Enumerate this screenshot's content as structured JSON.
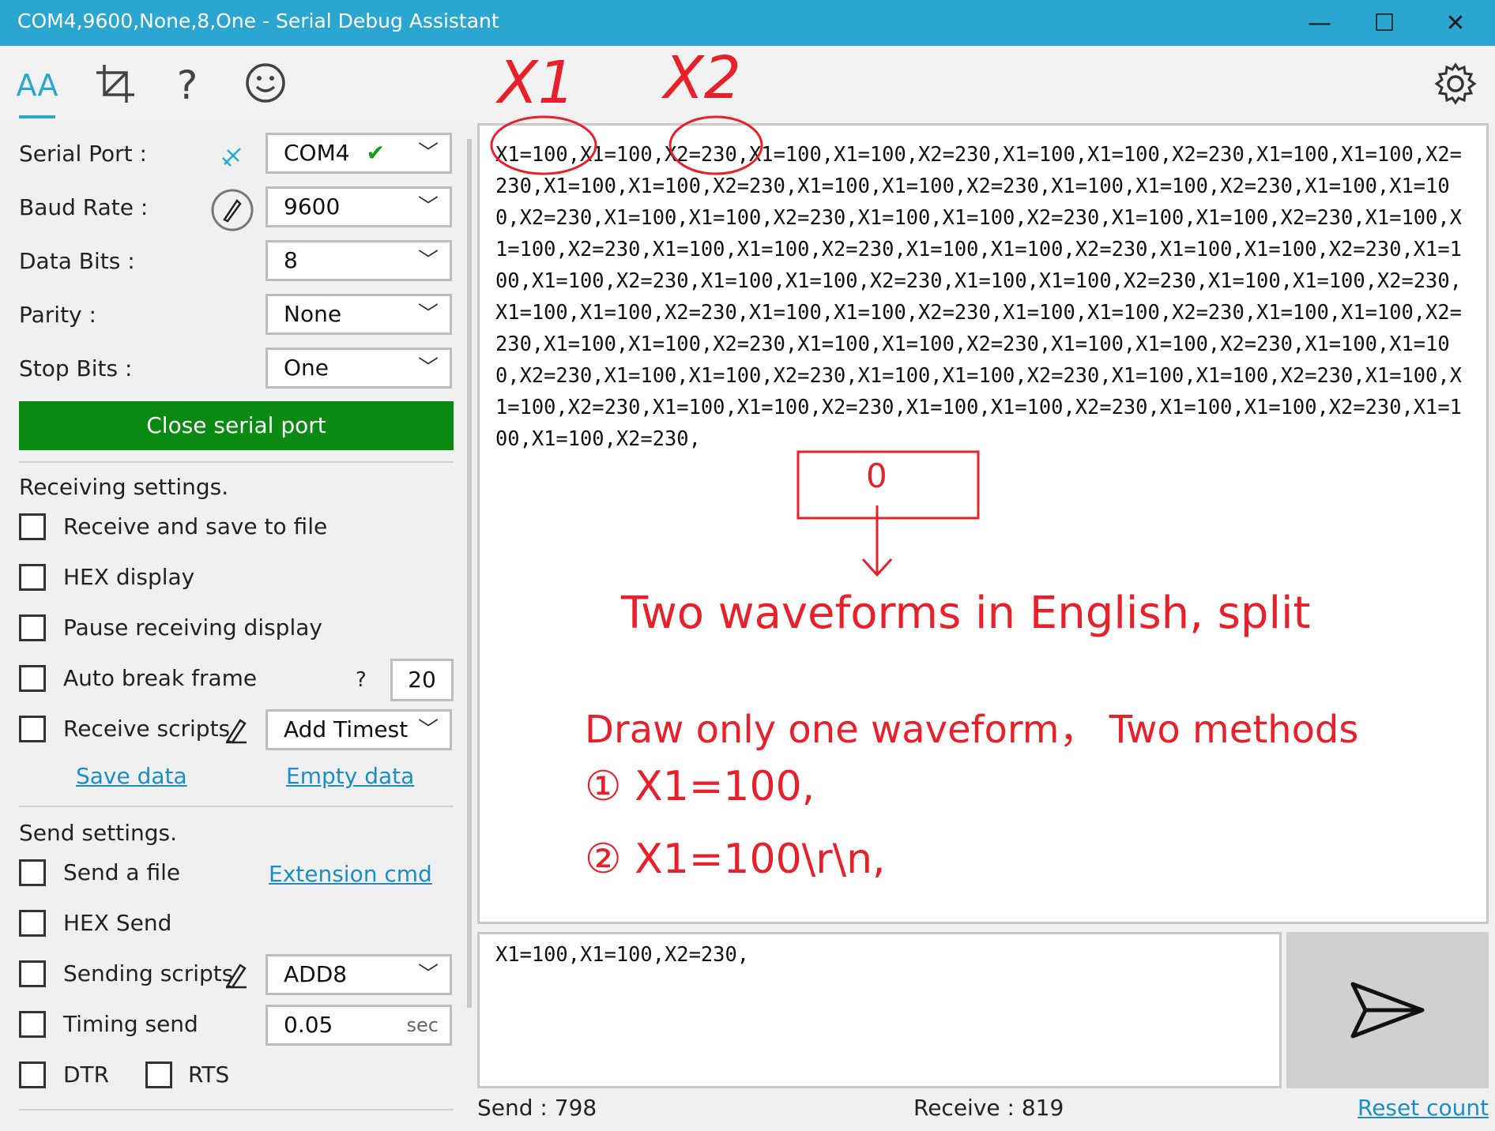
{
  "window": {
    "title": "COM4,9600,None,8,One - Serial Debug Assistant",
    "minimize": "—",
    "maximize": "☐",
    "close": "✕"
  },
  "toolbar": {
    "font_icon": "AA",
    "crop_icon": "crop-icon",
    "help": "?",
    "smile_icon": "smiley-icon",
    "settings_icon": "gear-icon"
  },
  "serial": {
    "port_label": "Serial Port :",
    "port_value": "COM4",
    "baud_label": "Baud Rate :",
    "baud_value": "9600",
    "databits_label": "Data Bits :",
    "databits_value": "8",
    "parity_label": "Parity :",
    "parity_value": "None",
    "stopbits_label": "Stop Bits :",
    "stopbits_value": "One",
    "close_button": "Close serial port"
  },
  "receiving": {
    "heading": "Receiving settings.",
    "save_to_file": "Receive and save to file",
    "hex_display": "HEX display",
    "pause_display": "Pause receiving display",
    "auto_break": "Auto break frame",
    "auto_break_help": "?",
    "auto_break_value": "20",
    "receive_scripts": "Receive scripts",
    "receive_scripts_value": "Add Timest",
    "save_data": "Save data",
    "empty_data": "Empty data"
  },
  "sending": {
    "heading": "Send settings.",
    "send_file": "Send a file",
    "extension_cmd": "Extension cmd",
    "hex_send": "HEX Send",
    "sending_scripts": "Sending scripts",
    "sending_scripts_value": "ADD8",
    "timing_send": "Timing send",
    "timing_value": "0.05",
    "timing_unit": "sec",
    "dtr": "DTR",
    "rts": "RTS"
  },
  "receive_area": {
    "text": "X1=100,X1=100,X2=230,X1=100,X1=100,X2=230,X1=100,X1=100,X2=230,X1=100,X1=100,X2=230,X1=100,X1=100,X2=230,X1=100,X1=100,X2=230,X1=100,X1=100,X2=230,X1=100,X1=100,X2=230,X1=100,X1=100,X2=230,X1=100,X1=100,X2=230,X1=100,X1=100,X2=230,X1=100,X1=100,X2=230,X1=100,X1=100,X2=230,X1=100,X1=100,X2=230,X1=100,X1=100,X2=230,X1=100,X1=100,X2=230,X1=100,X1=100,X2=230,X1=100,X1=100,X2=230,X1=100,X1=100,X2=230,X1=100,X1=100,X2=230,X1=100,X1=100,X2=230,X1=100,X1=100,X2=230,X1=100,X1=100,X2=230,X1=100,X1=100,X2=230,X1=100,X1=100,X2=230,X1=100,X1=100,X2=230,X1=100,X1=100,X2=230,X1=100,X1=100,X2=230,X1=100,X1=100,X2=230,X1=100,X1=100,X2=230,X1=100,X1=100,X2=230,X1=100,X1=100,X2=230,X1=100,X1=100,X2=230,X1=100,X1=100,X2=230,X1=100,X1=100,X2=230,"
  },
  "annotations": {
    "x1": "X1",
    "x2": "X2",
    "zero": "0",
    "line1": "Two waveforms in English, split",
    "line2": "Draw only one waveform， Two methods",
    "method1": "① X1=100,",
    "method2": "② X1=100\\r\\n,",
    "color": "#e8202a"
  },
  "send_area": {
    "text": "X1=100,X1=100,X2=230,"
  },
  "status": {
    "send": "Send : 798",
    "receive": "Receive : 819",
    "reset": "Reset count"
  },
  "colors": {
    "titlebar": "#2aa6d0",
    "close_button": "#0a8a12",
    "link": "#1a8fc6"
  }
}
